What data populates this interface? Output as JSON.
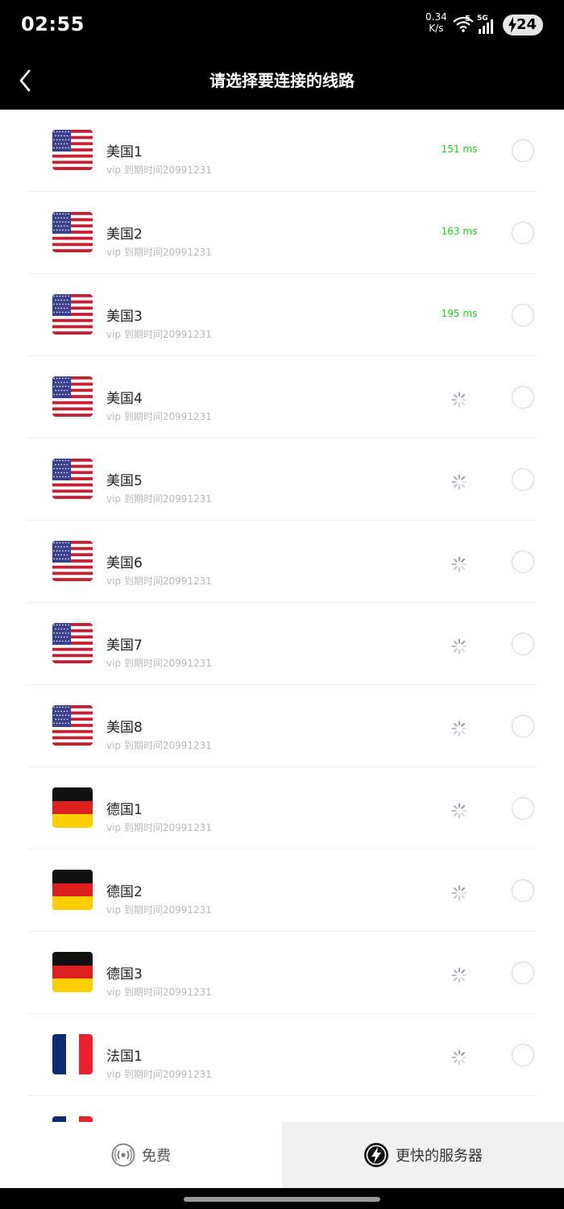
{
  "status_bar": {
    "time": "02:55",
    "net_speed_value": "0.34",
    "net_speed_unit": "K/s",
    "signal_label": "5G",
    "battery": "24"
  },
  "header": {
    "title": "请选择要连接的线路",
    "back_icon": "chevron-left-icon"
  },
  "servers": [
    {
      "name": "美国1",
      "sub": "vip  到期时间20991231",
      "flag": "us",
      "latency": "151 ms"
    },
    {
      "name": "美国2",
      "sub": "vip  到期时间20991231",
      "flag": "us",
      "latency": "163 ms"
    },
    {
      "name": "美国3",
      "sub": "vip  到期时间20991231",
      "flag": "us",
      "latency": "195 ms"
    },
    {
      "name": "美国4",
      "sub": "vip  到期时间20991231",
      "flag": "us",
      "latency": ""
    },
    {
      "name": "美国5",
      "sub": "vip  到期时间20991231",
      "flag": "us",
      "latency": ""
    },
    {
      "name": "美国6",
      "sub": "vip  到期时间20991231",
      "flag": "us",
      "latency": ""
    },
    {
      "name": "美国7",
      "sub": "vip  到期时间20991231",
      "flag": "us",
      "latency": ""
    },
    {
      "name": "美国8",
      "sub": "vip  到期时间20991231",
      "flag": "us",
      "latency": ""
    },
    {
      "name": "德国1",
      "sub": "vip  到期时间20991231",
      "flag": "de",
      "latency": ""
    },
    {
      "name": "德国2",
      "sub": "vip  到期时间20991231",
      "flag": "de",
      "latency": ""
    },
    {
      "name": "德国3",
      "sub": "vip  到期时间20991231",
      "flag": "de",
      "latency": ""
    },
    {
      "name": "法国1",
      "sub": "vip  到期时间20991231",
      "flag": "fr",
      "latency": ""
    }
  ],
  "tabs": {
    "free": {
      "label": "免费",
      "icon": "broadcast-icon"
    },
    "fast": {
      "label": "更快的服务器",
      "icon": "lightning-icon"
    }
  },
  "colors": {
    "header_bg": "#000000",
    "latency_good": "#1ed01e",
    "subtext": "#b9b9b9"
  }
}
